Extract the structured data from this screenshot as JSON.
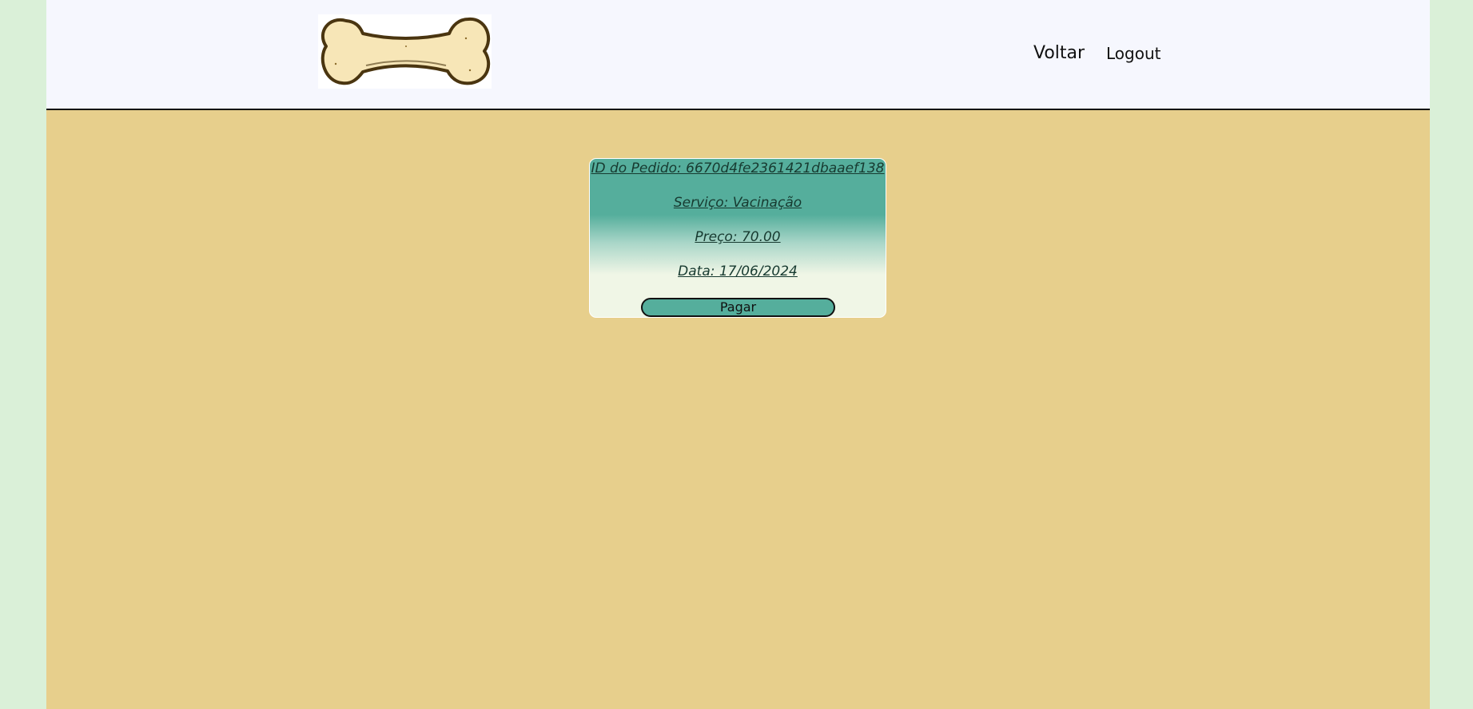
{
  "header": {
    "logo": "bone-logo",
    "nav": {
      "back_label": "Voltar",
      "logout_label": "Logout"
    }
  },
  "order": {
    "id_text": "ID do Pedido: 6670d4fe2361421dbaaef138",
    "service_text": "Serviço: Vacinação",
    "price_text": "Preço: 70.00",
    "date_text": "Data: 17/06/2024",
    "pay_label": "Pagar"
  },
  "colors": {
    "outer_background": "#daf0d8",
    "page_background": "#e7cf8c",
    "header_background": "#f6f7fe",
    "accent": "#55ae9c"
  }
}
